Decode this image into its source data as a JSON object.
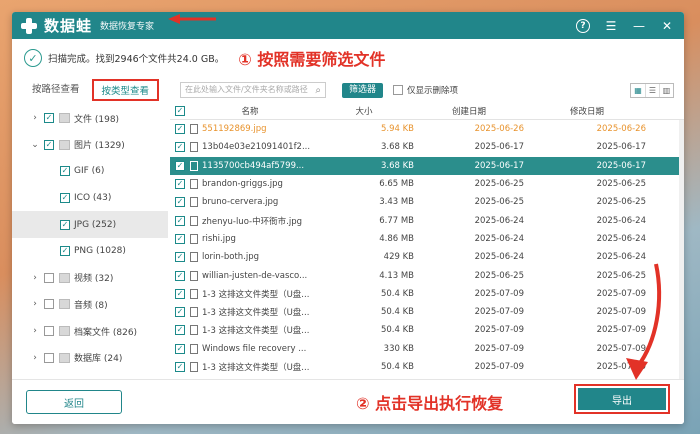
{
  "app": {
    "brand": "数据蛙",
    "subtitle": "数据恢复专家"
  },
  "status": {
    "text": "扫描完成。找到2946个文件共24.0 GB。"
  },
  "annotations": {
    "step1": "① 按照需要筛选文件",
    "step2": "② 点击导出执行恢复"
  },
  "tabs": {
    "by_path": "按路径查看",
    "by_type": "按类型查看"
  },
  "tree": [
    {
      "label": "文件 (198)",
      "expand": "›",
      "checked": true,
      "indent": 0
    },
    {
      "label": "图片 (1329)",
      "expand": "⌄",
      "checked": true,
      "indent": 0
    },
    {
      "label": "GIF (6)",
      "expand": "",
      "checked": true,
      "indent": 1
    },
    {
      "label": "ICO (43)",
      "expand": "",
      "checked": true,
      "indent": 1
    },
    {
      "label": "JPG (252)",
      "expand": "",
      "checked": true,
      "indent": 1,
      "selected": true
    },
    {
      "label": "PNG (1028)",
      "expand": "",
      "checked": true,
      "indent": 1
    },
    {
      "label": "视频 (32)",
      "expand": "›",
      "checked": false,
      "indent": 0
    },
    {
      "label": "音频 (8)",
      "expand": "›",
      "checked": false,
      "indent": 0
    },
    {
      "label": "档案文件 (826)",
      "expand": "›",
      "checked": false,
      "indent": 0
    },
    {
      "label": "数据库 (24)",
      "expand": "›",
      "checked": false,
      "indent": 0
    },
    {
      "label": "其他 (529)",
      "expand": "›",
      "checked": false,
      "indent": 0
    }
  ],
  "toolbar": {
    "search_placeholder": "在此处输入文件/文件夹名称或路径",
    "filter_label": "筛选器",
    "show_deleted": "仅显示删除项"
  },
  "table": {
    "headers": [
      "名称",
      "大小",
      "创建日期",
      "修改日期"
    ],
    "rows": [
      {
        "name": "551192869.jpg",
        "size": "5.94 KB",
        "created": "2025-06-26",
        "modified": "2025-06-26",
        "style": "orange"
      },
      {
        "name": "13b04e03e21091401f2...",
        "size": "3.68 KB",
        "created": "2025-06-17",
        "modified": "2025-06-17",
        "style": ""
      },
      {
        "name": "1135700cb494af5799...",
        "size": "3.68 KB",
        "created": "2025-06-17",
        "modified": "2025-06-17",
        "style": "sel"
      },
      {
        "name": "brandon-griggs.jpg",
        "size": "6.65 MB",
        "created": "2025-06-25",
        "modified": "2025-06-25",
        "style": ""
      },
      {
        "name": "bruno-cervera.jpg",
        "size": "3.43 MB",
        "created": "2025-06-25",
        "modified": "2025-06-25",
        "style": ""
      },
      {
        "name": "zhenyu-luo-中环衙市.jpg",
        "size": "6.77 MB",
        "created": "2025-06-24",
        "modified": "2025-06-24",
        "style": ""
      },
      {
        "name": "rishi.jpg",
        "size": "4.86 MB",
        "created": "2025-06-24",
        "modified": "2025-06-24",
        "style": ""
      },
      {
        "name": "lorin-both.jpg",
        "size": "429 KB",
        "created": "2025-06-24",
        "modified": "2025-06-24",
        "style": ""
      },
      {
        "name": "willian-justen-de-vasco...",
        "size": "4.13 MB",
        "created": "2025-06-25",
        "modified": "2025-06-25",
        "style": ""
      },
      {
        "name": "1-3 这排这文件类型（U盘...",
        "size": "50.4 KB",
        "created": "2025-07-09",
        "modified": "2025-07-09",
        "style": ""
      },
      {
        "name": "1-3 这排这文件类型（U盘...",
        "size": "50.4 KB",
        "created": "2025-07-09",
        "modified": "2025-07-09",
        "style": ""
      },
      {
        "name": "1-3 这排这文件类型（U盘...",
        "size": "50.4 KB",
        "created": "2025-07-09",
        "modified": "2025-07-09",
        "style": ""
      },
      {
        "name": "Windows file recovery ...",
        "size": "330 KB",
        "created": "2025-07-09",
        "modified": "2025-07-09",
        "style": ""
      },
      {
        "name": "1-3 这排这文件类型（U盘...",
        "size": "50.4 KB",
        "created": "2025-07-09",
        "modified": "2025-07-09",
        "style": ""
      },
      {
        "name": "1-3 这排这文件类型（U盘...",
        "size": "50.4 KB",
        "created": "2025-07-09",
        "modified": "2025-07-09",
        "style": ""
      },
      {
        "name": "Windows file recovery ...",
        "size": "330 KB",
        "created": "2025-07-09",
        "modified": "2025-07-09",
        "style": ""
      }
    ]
  },
  "bottom": {
    "back_label": "返回",
    "export_label": "导出"
  },
  "colors": {
    "primary": "#21868a",
    "annotation": "#e23227",
    "highlight_row": "#2b8e8c",
    "orange_row": "#e8932d"
  }
}
